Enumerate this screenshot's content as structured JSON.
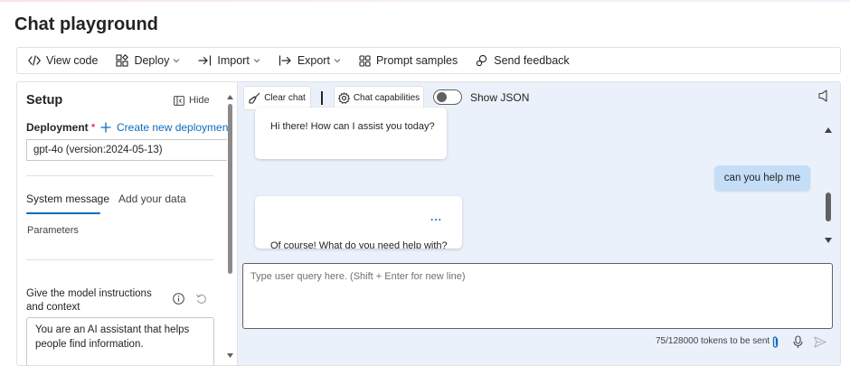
{
  "page": {
    "title": "Chat playground"
  },
  "toolbar": {
    "view_code": "View code",
    "deploy": "Deploy",
    "import": "Import",
    "export": "Export",
    "prompt_samples": "Prompt samples",
    "send_feedback": "Send feedback"
  },
  "setup": {
    "title": "Setup",
    "hide_label": "Hide",
    "deployment_label": "Deployment",
    "required_mark": "*",
    "create_new_deployment": "Create new deployment",
    "deployment_value": "gpt-4o (version:2024-05-13)",
    "tabs": [
      {
        "label": "System message",
        "active": true
      },
      {
        "label": "Add your data",
        "active": false
      }
    ],
    "parameters_label": "Parameters",
    "instructions_label": "Give the model instructions and context",
    "system_message": "You are an AI assistant that helps people find information."
  },
  "chat": {
    "clear_chat": "Clear chat",
    "chat_capabilities": "Chat capabilities",
    "show_json_label": "Show JSON",
    "show_json_enabled": false,
    "messages": [
      {
        "role": "assistant",
        "text": "Hi there! How can I assist you today?"
      },
      {
        "role": "user",
        "text": "can you help me"
      },
      {
        "role": "assistant",
        "text": "Of course! What do you need help with?",
        "actions": "..."
      }
    ],
    "input_placeholder": "Type user query here. (Shift + Enter for new line)",
    "tokens_text": "75/128000 tokens to be sent"
  },
  "colors": {
    "accent": "#0f6cbd",
    "chat_background": "#ebf1fb",
    "user_bubble": "#c4def7",
    "required": "#c50f1f"
  }
}
